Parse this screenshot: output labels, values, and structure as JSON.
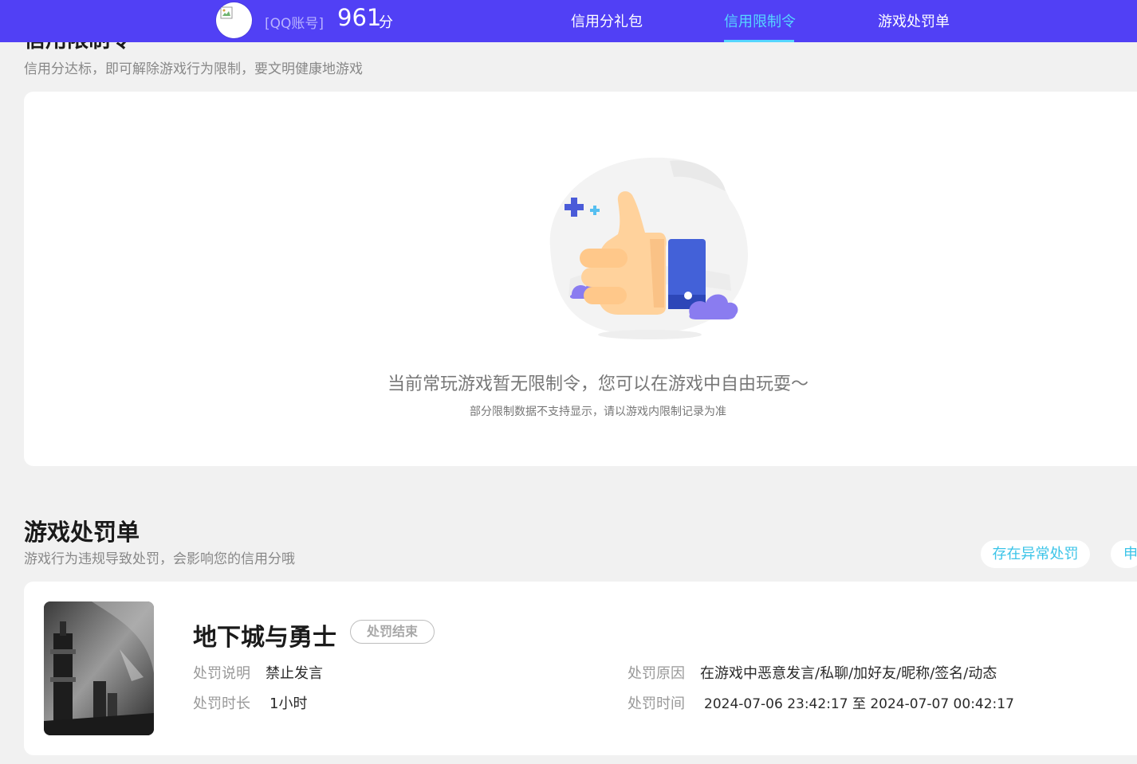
{
  "header": {
    "account_label": "[QQ账号]",
    "score": "961",
    "score_unit": "分",
    "tabs": [
      {
        "label": "信用分礼包",
        "active": false
      },
      {
        "label": "信用限制令",
        "active": true
      },
      {
        "label": "游戏处罚单",
        "active": false
      }
    ]
  },
  "restriction": {
    "title": "信用限制令",
    "subtitle": "信用分达标，即可解除游戏行为限制，要文明健康地游戏",
    "empty_message": "当前常玩游戏暂无限制令，您可以在游戏中自由玩耍～",
    "empty_note": "部分限制数据不支持显示，请以游戏内限制记录为准"
  },
  "penalty": {
    "title": "游戏处罚单",
    "subtitle": "游戏行为违规导致处罚，会影响您的信用分哦",
    "buttons": [
      "存在异常处罚",
      "申"
    ],
    "record": {
      "game": "地下城与勇士",
      "status": "处罚结束",
      "desc_label": "处罚说明",
      "desc_value": "禁止发言",
      "reason_label": "处罚原因",
      "reason_value": "在游戏中恶意发言/私聊/加好友/昵称/签名/动态",
      "duration_label": "处罚时长",
      "duration_value": "1小时",
      "time_label": "处罚时间",
      "time_value": "2024-07-06 23:42:17 至 2024-07-07 00:42:17"
    }
  },
  "colors": {
    "nav_bg": "#5140f5",
    "accent": "#56d6ff",
    "button_text": "#3bc4e8",
    "page_bg": "#f1f1f1"
  },
  "icons": {
    "avatar": "broken-image-icon",
    "empty_state": "thumbs-up-illustration"
  }
}
